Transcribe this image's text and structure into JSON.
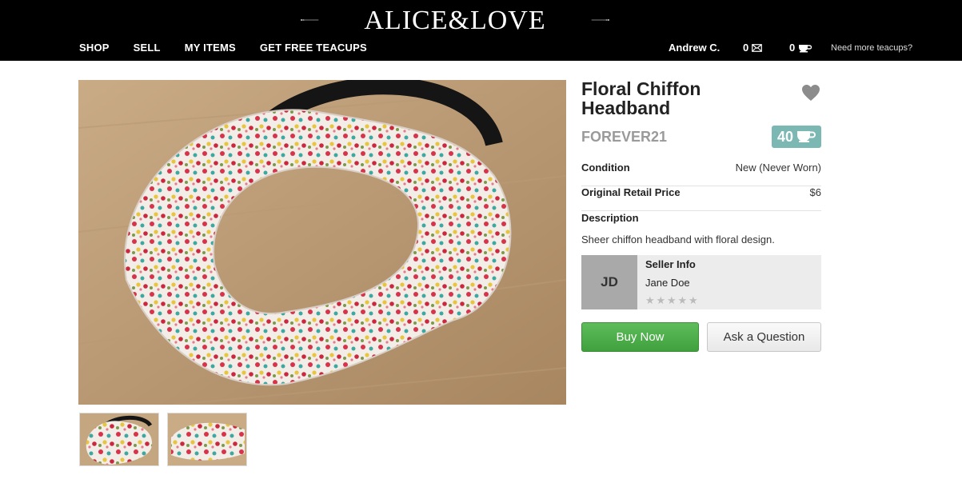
{
  "header": {
    "logo_text": "ALICE&LOVE",
    "nav": [
      "SHOP",
      "SELL",
      "MY ITEMS",
      "GET FREE TEACUPS"
    ],
    "user_name": "Andrew C.",
    "messages_count": "0",
    "teacups_count": "0",
    "more_teacups_link": "Need more teacups?"
  },
  "product": {
    "title": "Floral Chiffon Headband",
    "brand": "FOREVER21",
    "teacup_price": "40",
    "details": [
      {
        "label": "Condition",
        "value": "New (Never Worn)"
      },
      {
        "label": "Original Retail Price",
        "value": "$6"
      }
    ],
    "description_label": "Description",
    "description": "Sheer chiffon headband with floral design.",
    "image_icon": "floral-headband-photo",
    "thumbnail_count": 2
  },
  "seller": {
    "section_title": "Seller Info",
    "initials": "JD",
    "name": "Jane Doe",
    "rating": 0,
    "rating_max": 5
  },
  "actions": {
    "buy_label": "Buy Now",
    "ask_label": "Ask a Question"
  },
  "colors": {
    "header_bg": "#000000",
    "teacup_badge": "#7bb8b4",
    "buy_button": "#4caf4a",
    "brand_text": "#9a9a9a"
  }
}
